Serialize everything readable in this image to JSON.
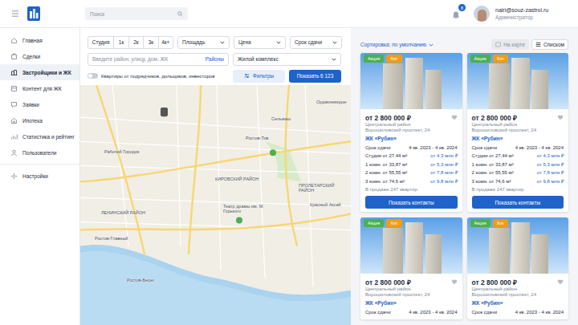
{
  "header": {
    "search_placeholder": "Поиск",
    "notifications": "8",
    "user": {
      "email": "nairi@souz-zastroi.ru",
      "role": "Администратор"
    }
  },
  "sidebar": {
    "items": [
      {
        "label": "Главная",
        "selected": false
      },
      {
        "label": "Сделки",
        "selected": false
      },
      {
        "label": "Застройщики и ЖК",
        "selected": true
      },
      {
        "label": "Контент для ЖК",
        "selected": false
      },
      {
        "label": "Заявки",
        "selected": false
      },
      {
        "label": "Ипотека",
        "selected": false
      },
      {
        "label": "Статистика и рейтинг",
        "selected": false
      },
      {
        "label": "Пользователи",
        "selected": false
      }
    ],
    "settings": {
      "label": "Настройки",
      "selected": false
    }
  },
  "filters": {
    "rooms": [
      {
        "label": "Студия",
        "selected": false
      },
      {
        "label": "1к",
        "selected": false
      },
      {
        "label": "2к",
        "selected": false
      },
      {
        "label": "3к",
        "selected": false
      },
      {
        "label": "4к+",
        "selected": false
      }
    ],
    "dropdowns": [
      "Площадь",
      "Цена",
      "Срок сдачи"
    ],
    "search": {
      "placeholder": "Введите район, улицу, дом, ЖК",
      "link": "Районы"
    },
    "complex": "Жилой комплекс",
    "toggle": {
      "label": "Квартиры от подрядчиков, дольщиков, инвесторов",
      "on": false
    },
    "filters_button": "Фильтры",
    "show_button": "Показать 6 123"
  },
  "map": {
    "labels": [
      "Орджоникидзе",
      "Сельмаш",
      "Рабочий Городок",
      "Ростов-Тов",
      "КИРОВСКИЙ РАЙОН",
      "ЛЕНИНСКИЙ РАЙОН",
      "ПРОЛЕТАРСКИЙ РАЙОН",
      "Театр драмы им. М. Горького",
      "Красный Аксай",
      "Ростов-Главный",
      "Ростов-Берег"
    ]
  },
  "listing": {
    "sort": "Сортировка: по умолчанию",
    "views": [
      {
        "label": "На карте",
        "selected": false
      },
      {
        "label": "Списком",
        "selected": true
      }
    ],
    "cards": [
      {
        "badges": [
          {
            "label": "Акция",
            "color": "#4caf50"
          },
          {
            "label": "Хит",
            "color": "#f39c12"
          }
        ],
        "price": "от 2 800 000 ₽",
        "favorite": false,
        "district": "Центральный район",
        "address": "Ворошиловский проспект, 24",
        "complex": "ЖК «Рубин»",
        "deadline_label": "Срок сдачи",
        "deadline": "4 кв. 2023 - 4 кв. 2024",
        "rows": [
          {
            "type": "Студии от 27,44 м²",
            "price": "от 4,3 млн ₽"
          },
          {
            "type": "1 комн. от 33,87 м²",
            "price": "от 5,3 млн ₽"
          },
          {
            "type": "2 комн. от 55,55 м²",
            "price": "от 7,8 млн ₽"
          },
          {
            "type": "3 комн. от 74,6 м²",
            "price": "от 9,8 млн ₽"
          }
        ],
        "stock": "В продаже 247 квартир",
        "button": "Показать контакты"
      },
      {
        "badges": [
          {
            "label": "Акция",
            "color": "#4caf50"
          },
          {
            "label": "Хит",
            "color": "#f39c12"
          }
        ],
        "price": "от 2 800 000 ₽",
        "favorite": false,
        "district": "Центральный район",
        "address": "Ворошиловский проспект, 24",
        "complex": "ЖК «Рубин»",
        "deadline_label": "Срок сдачи",
        "deadline": "4 кв. 2023 - 4 кв. 2024",
        "rows": [
          {
            "type": "Студии от 27,44 м²",
            "price": "от 4,3 млн ₽"
          },
          {
            "type": "1 комн. от 33,87 м²",
            "price": "от 5,3 млн ₽"
          },
          {
            "type": "2 комн. от 55,55 м²",
            "price": "от 7,8 млн ₽"
          },
          {
            "type": "3 комн. от 74,6 м²",
            "price": "от 9,8 млн ₽"
          }
        ],
        "stock": "В продаже 247 квартир",
        "button": "Показать контакты"
      },
      {
        "badges": [
          {
            "label": "Акция",
            "color": "#4caf50"
          },
          {
            "label": "Хит",
            "color": "#f39c12"
          }
        ],
        "price": "от 2 800 000 ₽",
        "favorite": false,
        "district": "Центральный район",
        "address": "Ворошиловский проспект, 24",
        "complex": "ЖК «Рубин»",
        "deadline_label": "Срок сдачи",
        "deadline": "4 кв. 2023 - 4 кв. 2024"
      },
      {
        "badges": [
          {
            "label": "Акция",
            "color": "#4caf50"
          },
          {
            "label": "Хит",
            "color": "#f39c12"
          }
        ],
        "price": "от 2 800 000 ₽",
        "favorite": false,
        "district": "Центральный район",
        "address": "Ворошиловский проспект, 24",
        "complex": "ЖК «Рубин»",
        "deadline_label": "Срок сдачи",
        "deadline": "4 кв. 2023 - 4 кв. 2024"
      }
    ]
  }
}
